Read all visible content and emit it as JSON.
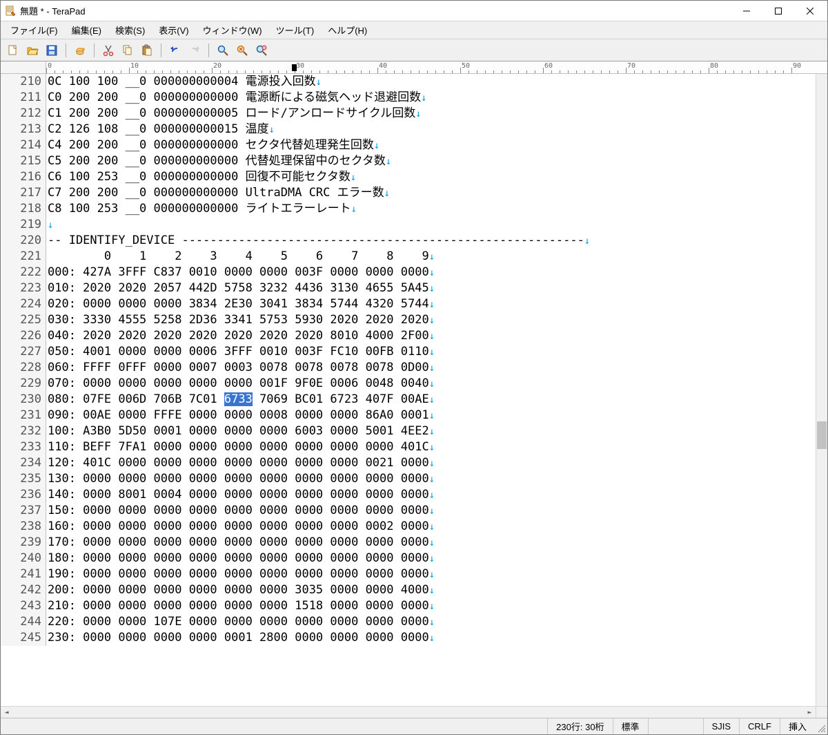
{
  "title": "無題 * - TeraPad",
  "menu": {
    "file": "ファイル(F)",
    "edit": "編集(E)",
    "search": "検索(S)",
    "view": "表示(V)",
    "window": "ウィンドウ(W)",
    "tool": "ツール(T)",
    "help": "ヘルプ(H)"
  },
  "ruler": {
    "caret_col": 30,
    "visible_max": 90
  },
  "editor": {
    "first_line_no": 210,
    "selection": {
      "line_index": 20,
      "text": "6733"
    },
    "lines": [
      "0C 100 100 __0 000000000004 電源投入回数",
      "C0 200 200 __0 000000000000 電源断による磁気ヘッド退避回数",
      "C1 200 200 __0 000000000005 ロード/アンロードサイクル回数",
      "C2 126 108 __0 000000000015 温度",
      "C4 200 200 __0 000000000000 セクタ代替処理発生回数",
      "C5 200 200 __0 000000000000 代替処理保留中のセクタ数",
      "C6 100 253 __0 000000000000 回復不可能セクタ数",
      "C7 200 200 __0 000000000000 UltraDMA CRC エラー数",
      "C8 100 253 __0 000000000000 ライトエラーレート",
      "",
      "-- IDENTIFY_DEVICE ---------------------------------------------------------",
      "        0    1    2    3    4    5    6    7    8    9",
      "000: 427A 3FFF C837 0010 0000 0000 003F 0000 0000 0000",
      "010: 2020 2020 2057 442D 5758 3232 4436 3130 4655 5A45",
      "020: 0000 0000 0000 3834 2E30 3041 3834 5744 4320 5744",
      "030: 3330 4555 5258 2D36 3341 5753 5930 2020 2020 2020",
      "040: 2020 2020 2020 2020 2020 2020 2020 8010 4000 2F00",
      "050: 4001 0000 0000 0006 3FFF 0010 003F FC10 00FB 0110",
      "060: FFFF 0FFF 0000 0007 0003 0078 0078 0078 0078 0D00",
      "070: 0000 0000 0000 0000 0000 001F 9F0E 0006 0048 0040",
      "080: 07FE 006D 706B 7C01 6733 7069 BC01 6723 407F 00AE",
      "090: 00AE 0000 FFFE 0000 0000 0008 0000 0000 86A0 0001",
      "100: A3B0 5D50 0001 0000 0000 0000 6003 0000 5001 4EE2",
      "110: BEFF 7FA1 0000 0000 0000 0000 0000 0000 0000 401C",
      "120: 401C 0000 0000 0000 0000 0000 0000 0000 0021 0000",
      "130: 0000 0000 0000 0000 0000 0000 0000 0000 0000 0000",
      "140: 0000 8001 0004 0000 0000 0000 0000 0000 0000 0000",
      "150: 0000 0000 0000 0000 0000 0000 0000 0000 0000 0000",
      "160: 0000 0000 0000 0000 0000 0000 0000 0000 0002 0000",
      "170: 0000 0000 0000 0000 0000 0000 0000 0000 0000 0000",
      "180: 0000 0000 0000 0000 0000 0000 0000 0000 0000 0000",
      "190: 0000 0000 0000 0000 0000 0000 0000 0000 0000 0000",
      "200: 0000 0000 0000 0000 0000 0000 3035 0000 0000 4000",
      "210: 0000 0000 0000 0000 0000 0000 1518 0000 0000 0000",
      "220: 0000 0000 107E 0000 0000 0000 0000 0000 0000 0000",
      "230: 0000 0000 0000 0000 0001 2800 0000 0000 0000 0000"
    ]
  },
  "statusbar": {
    "position": "230行:  30桁",
    "mode": "標準",
    "encoding": "SJIS",
    "linebreak": "CRLF",
    "insert": "挿入"
  }
}
